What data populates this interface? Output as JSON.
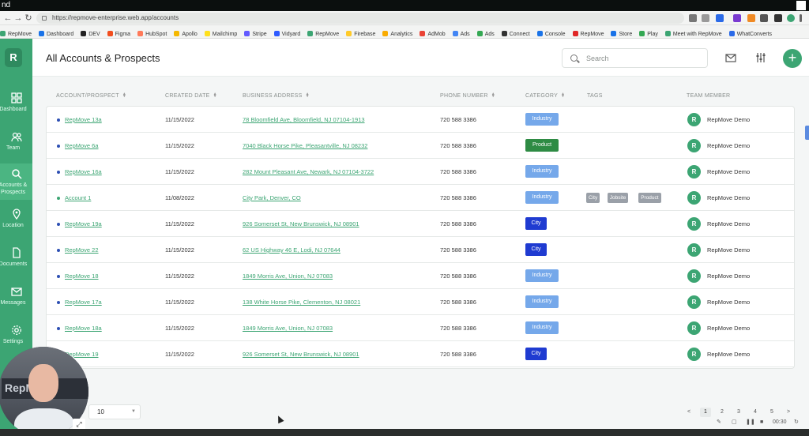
{
  "browser": {
    "title_fragment": "nd",
    "url": "https://repmove-enterprise.web.app/accounts",
    "bookmarks": [
      "RepMove",
      "Dashboard",
      "DEV",
      "Figma",
      "HubSpot",
      "Apollo",
      "Mailchimp",
      "Stripe",
      "Vidyard",
      "RepMove",
      "Firebase",
      "Analytics",
      "AdMob",
      "Ads",
      "Ads",
      "Connect",
      "Console",
      "RepMove",
      "Store",
      "Play",
      "Meet with RepMove",
      "WhatConverts"
    ],
    "bookmark_colors": [
      "#3ca573",
      "#1a73e8",
      "#222222",
      "#f24e1e",
      "#ff7a59",
      "#f5b800",
      "#ffe01b",
      "#635bff",
      "#2e5bff",
      "#3ca573",
      "#ffca28",
      "#f9ab00",
      "#ea4335",
      "#4285f4",
      "#34a853",
      "#333333",
      "#1a73e8",
      "#e02727",
      "#1a73e8",
      "#34a853",
      "#3ca573",
      "#2a6ae8"
    ]
  },
  "sidebar": {
    "logo": "R",
    "items": [
      {
        "label": "Dashboard",
        "icon": "dashboard-icon"
      },
      {
        "label": "Team",
        "icon": "team-icon"
      },
      {
        "label": "Accounts & Prospects",
        "icon": "search-icon"
      },
      {
        "label": "Location",
        "icon": "location-icon"
      },
      {
        "label": "Documents",
        "icon": "document-icon"
      },
      {
        "label": "Messages",
        "icon": "mail-icon"
      },
      {
        "label": "Settings",
        "icon": "settings-icon"
      }
    ]
  },
  "header": {
    "title": "All Accounts & Prospects",
    "search_placeholder": "Search",
    "add_label": "+"
  },
  "table": {
    "columns": [
      "ACCOUNT/PROSPECT",
      "CREATED DATE",
      "BUSINESS ADDRESS",
      "PHONE NUMBER",
      "CATEGORY",
      "TAGS",
      "TEAM MEMBER"
    ],
    "rows": [
      {
        "name": "RepMove 13a",
        "date": "11/15/2022",
        "address": "78 Bloomfield Ave, Bloomfield, NJ 07104-1913",
        "phone": "720 588 3386",
        "category": "Industry",
        "tags": [],
        "member": "RepMove Demo",
        "dot": "blue"
      },
      {
        "name": "RepMove 6a",
        "date": "11/15/2022",
        "address": "7040 Black Horse Pike, Pleasantville, NJ 08232",
        "phone": "720 588 3386",
        "category": "Product",
        "tags": [],
        "member": "RepMove Demo",
        "dot": "blue"
      },
      {
        "name": "RepMove 16a",
        "date": "11/15/2022",
        "address": "282 Mount Pleasant Ave, Newark, NJ 07104-3722",
        "phone": "720 588 3386",
        "category": "Industry",
        "tags": [],
        "member": "RepMove Demo",
        "dot": "blue"
      },
      {
        "name": "Account 1",
        "date": "11/08/2022",
        "address": "City Park, Denver, CO",
        "phone": "720 588 3386",
        "category": "Industry",
        "tags": [
          "City",
          "Jobsite",
          "Product"
        ],
        "member": "RepMove Demo",
        "dot": "green"
      },
      {
        "name": "RepMove 19a",
        "date": "11/15/2022",
        "address": "926 Somerset St, New Brunswick, NJ 08901",
        "phone": "720 588 3386",
        "category": "City",
        "tags": [],
        "member": "RepMove Demo",
        "dot": "blue"
      },
      {
        "name": "RepMove 22",
        "date": "11/15/2022",
        "address": "62 US Highway 46 E, Lodi, NJ 07644",
        "phone": "720 588 3386",
        "category": "City",
        "tags": [],
        "member": "RepMove Demo",
        "dot": "blue"
      },
      {
        "name": "RepMove 18",
        "date": "11/15/2022",
        "address": "1849 Morris Ave, Union, NJ 07083",
        "phone": "720 588 3386",
        "category": "Industry",
        "tags": [],
        "member": "RepMove Demo",
        "dot": "blue"
      },
      {
        "name": "RepMove 17a",
        "date": "11/15/2022",
        "address": "138 White Horse Pike, Clementon, NJ 08021",
        "phone": "720 588 3386",
        "category": "Industry",
        "tags": [],
        "member": "RepMove Demo",
        "dot": "blue"
      },
      {
        "name": "RepMove 18a",
        "date": "11/15/2022",
        "address": "1849 Morris Ave, Union, NJ 07083",
        "phone": "720 588 3386",
        "category": "Industry",
        "tags": [],
        "member": "RepMove Demo",
        "dot": "blue"
      },
      {
        "name": "RepMove 19",
        "date": "11/15/2022",
        "address": "926 Somerset St, New Brunswick, NJ 08901",
        "phone": "720 588 3386",
        "category": "City",
        "tags": [],
        "member": "RepMove Demo",
        "dot": "blue"
      }
    ]
  },
  "footer": {
    "per_page": "10",
    "pages": [
      "<",
      "1",
      "2",
      "3",
      "4",
      "5",
      ">"
    ],
    "current_page": "1"
  },
  "player": {
    "webcam_text": "RepMove",
    "time": "00:30"
  },
  "colors": {
    "brand": "#3ca573",
    "industry": "#75a8ea",
    "product": "#2e8b44",
    "city": "#1f3bd1"
  }
}
